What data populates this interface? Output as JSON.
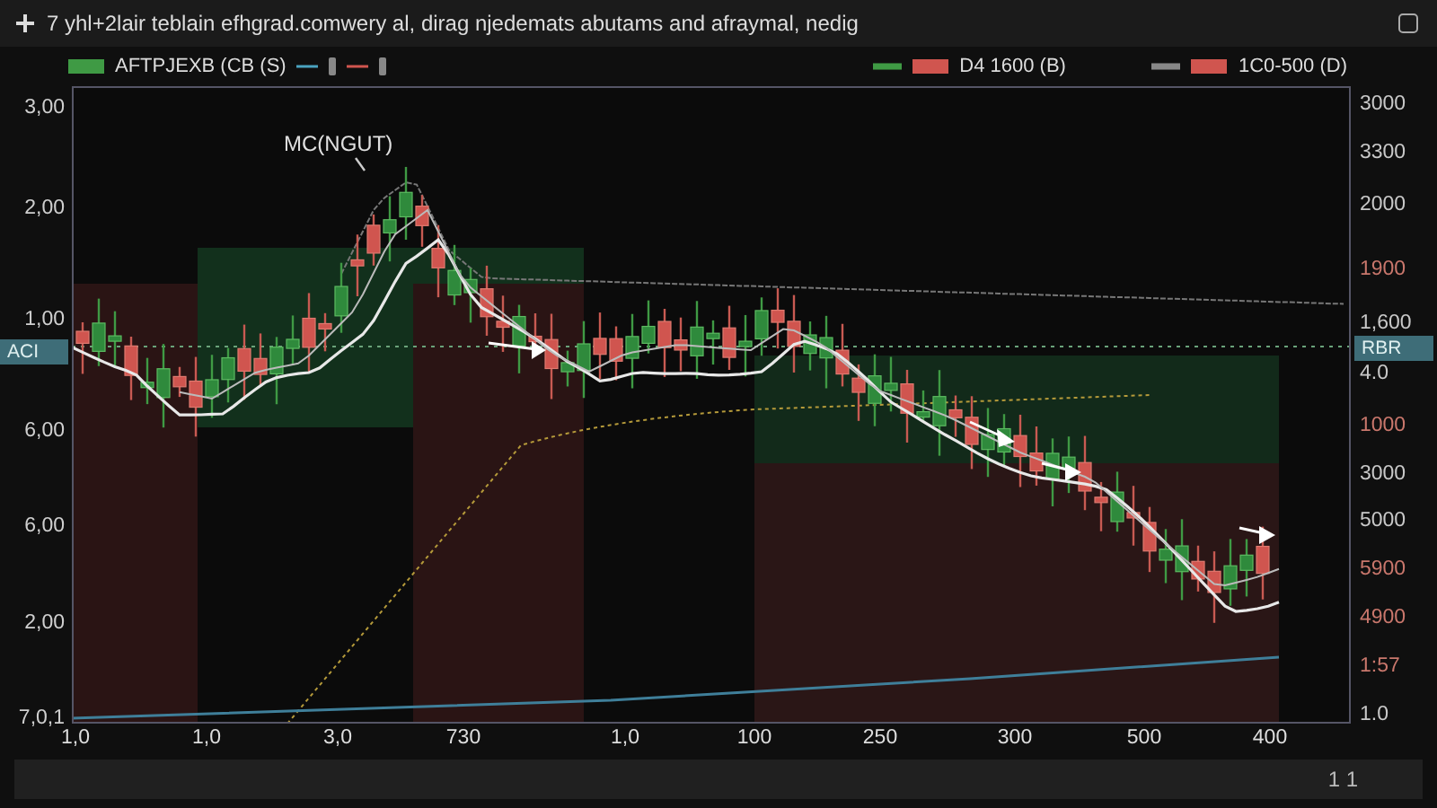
{
  "window": {
    "title": "7 yhl+2lair teblain efhgrad.comwery al, dirag njedemats abutams and afraymal, nedig"
  },
  "legend": [
    {
      "label": "AFTPJEXB (CB (S)",
      "color": "#3f9a44",
      "kind": "main"
    },
    {
      "label": "D4 1600 (B)",
      "color": "#d0554f",
      "kind": "series"
    },
    {
      "label": "1C0-500 (D)",
      "color": "#d0554f",
      "kind": "series"
    }
  ],
  "chart": {
    "annotation": "MC(NGUT)",
    "left_axis": [
      "3,00",
      "2,00",
      "1,00",
      "6,00",
      "6,00",
      "2,00",
      "7,0,1"
    ],
    "left_tag": "ACI",
    "right_axis": [
      {
        "label": "3000",
        "color": "#c8c8c8"
      },
      {
        "label": "3300",
        "color": "#c8c8c8"
      },
      {
        "label": "2000",
        "color": "#c8c8c8"
      },
      {
        "label": "1900",
        "color": "#c9776c"
      },
      {
        "label": "1,600",
        "color": "#c8c8c8"
      },
      {
        "label": "4.0",
        "color": "#c8c8c8"
      },
      {
        "label": "1000",
        "color": "#c9776c"
      },
      {
        "label": "3000",
        "color": "#c8c8c8"
      },
      {
        "label": "5000",
        "color": "#c8c8c8"
      },
      {
        "label": "5900",
        "color": "#c9776c"
      },
      {
        "label": "4900",
        "color": "#c9776c"
      },
      {
        "label": "1:57",
        "color": "#c9776c"
      },
      {
        "label": "1.0",
        "color": "#c8c8c8"
      }
    ],
    "right_tag": "RBR",
    "x_axis": [
      "1,0",
      "1,0",
      "3,0",
      "730",
      "1,0",
      "100",
      "250",
      "300",
      "500",
      "400"
    ]
  },
  "status_bar": {
    "text": "1 1"
  }
}
